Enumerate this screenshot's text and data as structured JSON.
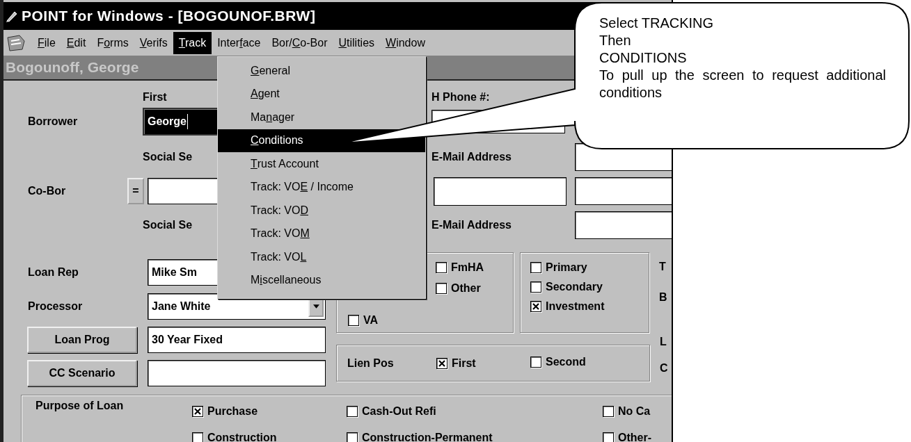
{
  "window": {
    "title": "POINT for Windows - [BOGOUNOF.BRW]"
  },
  "menu_bar": [
    {
      "key": "F",
      "post": "ile",
      "selected": false
    },
    {
      "key": "E",
      "post": "dit",
      "selected": false
    },
    {
      "pre": "F",
      "key": "o",
      "post": "rms",
      "selected": false
    },
    {
      "key": "V",
      "post": "erifs",
      "selected": false
    },
    {
      "key": "T",
      "post": "rack",
      "selected": true
    },
    {
      "pre": "Inter",
      "key": "f",
      "post": "ace",
      "selected": false
    },
    {
      "pre": "Bor/",
      "key": "C",
      "post": "o-Bor",
      "selected": false
    },
    {
      "key": "U",
      "post": "tilities",
      "selected": false
    },
    {
      "key": "W",
      "post": "indow",
      "selected": false
    }
  ],
  "record_bar": {
    "name": "Bogounoff, George"
  },
  "track_menu": [
    {
      "key": "G",
      "post": "eneral",
      "selected": false
    },
    {
      "key": "A",
      "post": "gent",
      "selected": false
    },
    {
      "pre": "Ma",
      "key": "n",
      "post": "ager",
      "selected": false
    },
    {
      "key": "C",
      "post": "onditions",
      "selected": true
    },
    {
      "key": "T",
      "post": "rust Account",
      "selected": false
    },
    {
      "pre": "Track: VO",
      "key": "E",
      "post": " / Income",
      "selected": false
    },
    {
      "pre": "Track: VO",
      "key": "D",
      "selected": false
    },
    {
      "pre": "Track: VO",
      "key": "M",
      "selected": false
    },
    {
      "pre": "Track: VO",
      "key": "L",
      "selected": false
    },
    {
      "pre": "M",
      "key": "i",
      "post": "scellaneous",
      "selected": false
    }
  ],
  "borrower": {
    "label": "Borrower",
    "first_label": "First",
    "first_value": "George",
    "phone_label": "H Phone #:",
    "ssn_label": "Social Se",
    "email_label": "E-Mail Address"
  },
  "co_borrower": {
    "label": "Co-Bor",
    "copy_button": "=",
    "ssn_label": "Social Se",
    "email_label": "E-Mail Address"
  },
  "loan": {
    "rep_label": "Loan Rep",
    "rep_value": "Mike Sm",
    "processor_label": "Processor",
    "processor_value": "Jane White",
    "program_button": "Loan Prog",
    "program_value": "30 Year Fixed",
    "scenario_button": "CC Scenario"
  },
  "loan_type": [
    {
      "label": "FmHA",
      "checked": false
    },
    {
      "label": "Other",
      "checked": false
    },
    {
      "label": "VA",
      "checked": false
    }
  ],
  "occupancy": [
    {
      "label": "Primary",
      "checked": false
    },
    {
      "label": "Secondary",
      "checked": false
    },
    {
      "label": "Investment",
      "checked": true
    }
  ],
  "side_labels": [
    "T",
    "B",
    "L",
    "C"
  ],
  "lien": {
    "label": "Lien Pos",
    "options": [
      {
        "label": "First",
        "checked": true
      },
      {
        "label": "Second",
        "checked": false
      }
    ]
  },
  "purpose": {
    "label": "Purpose of Loan",
    "options": [
      {
        "label": "Purchase",
        "checked": true
      },
      {
        "label": "Cash-Out Refi",
        "checked": false
      },
      {
        "label": "No Ca",
        "checked": false
      },
      {
        "label": "Construction",
        "checked": false
      },
      {
        "label": "Construction-Permanent",
        "checked": false
      },
      {
        "label": "Other-",
        "checked": false
      }
    ]
  },
  "callout": {
    "lines": [
      "Select TRACKING",
      "Then",
      "CONDITIONS",
      "To pull up the screen to request additional conditions"
    ]
  }
}
